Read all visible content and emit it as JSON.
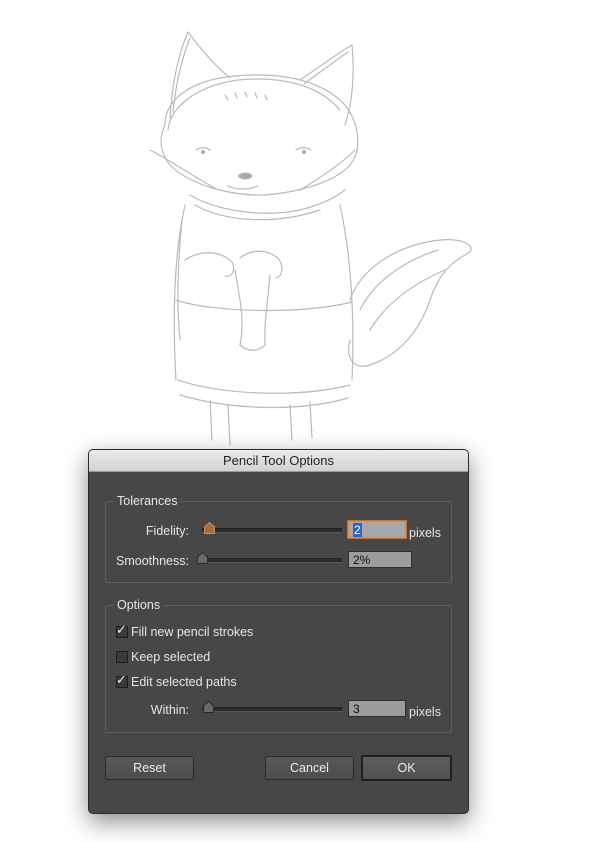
{
  "dialog": {
    "title": "Pencil Tool Options",
    "tolerances": {
      "group_label": "Tolerances",
      "fidelity": {
        "label": "Fidelity:",
        "value": "2",
        "unit": "pixels"
      },
      "smoothness": {
        "label": "Smoothness:",
        "value": "2%"
      }
    },
    "options": {
      "group_label": "Options",
      "checkboxes": [
        {
          "label": "Fill new pencil strokes",
          "checked": true
        },
        {
          "label": "Keep selected",
          "checked": false
        },
        {
          "label": "Edit selected paths",
          "checked": true
        }
      ],
      "within": {
        "label": "Within:",
        "value": "3",
        "unit": "pixels"
      }
    },
    "buttons": {
      "reset": "Reset",
      "cancel": "Cancel",
      "ok": "OK"
    }
  },
  "colors": {
    "dialog_bg": "#474747",
    "focus_ring": "#e58a3b",
    "sketch_line": "#b9b4b6"
  }
}
